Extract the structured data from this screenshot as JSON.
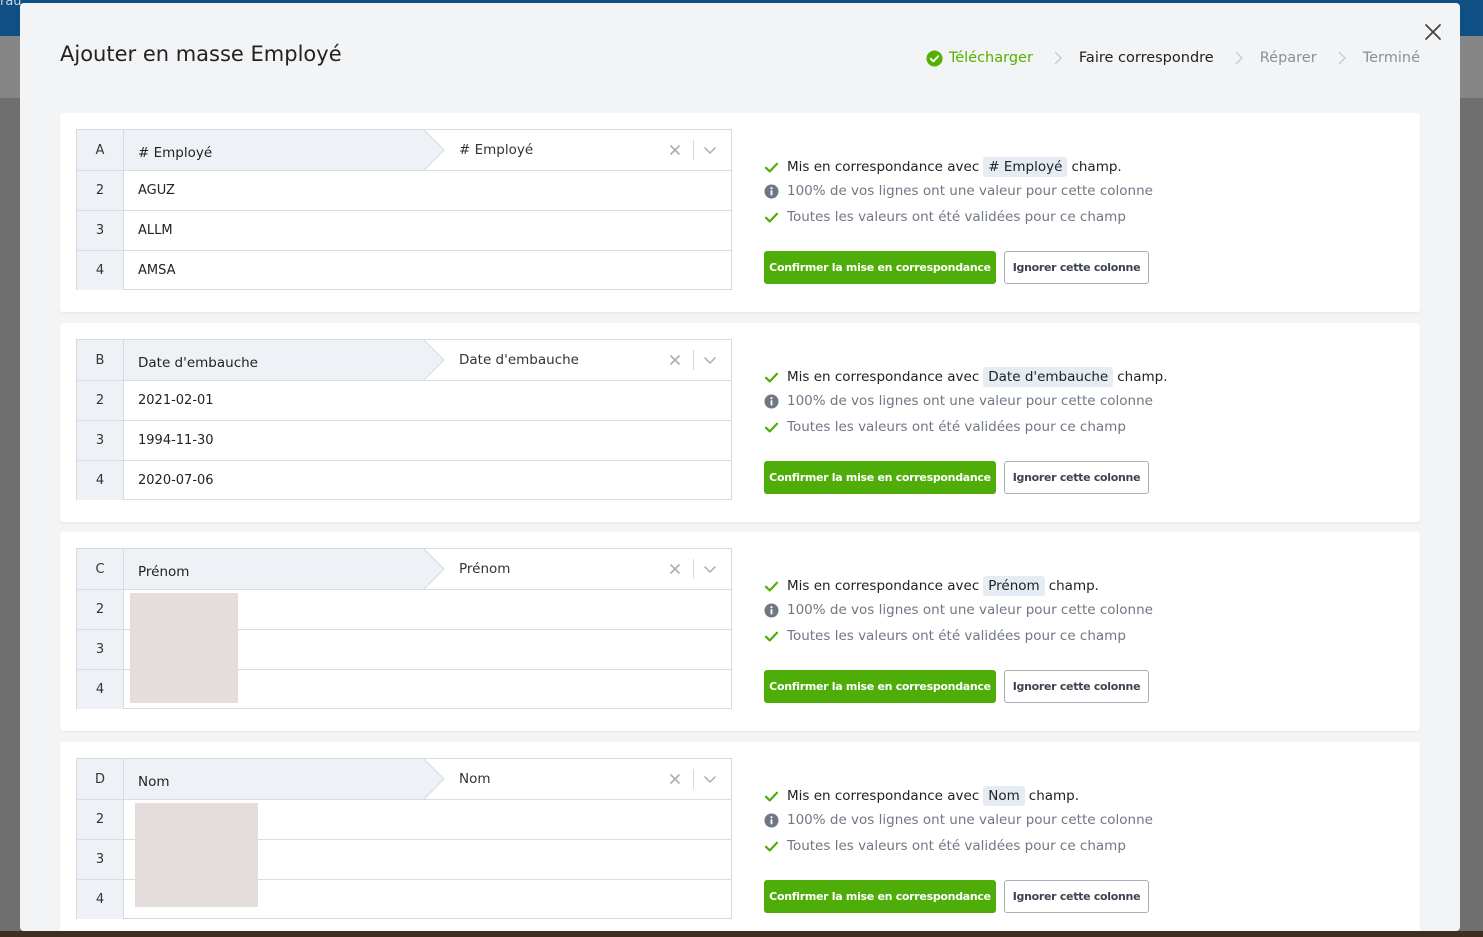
{
  "backdrop": {
    "corner_text": "rau"
  },
  "modal": {
    "title": "Ajouter en masse Employé",
    "close_icon": "close-icon",
    "steps": [
      {
        "label": "Télécharger",
        "state": "done"
      },
      {
        "label": "Faire correspondre",
        "state": "active"
      },
      {
        "label": "Réparer",
        "state": "todo"
      },
      {
        "label": "Terminé",
        "state": "todo"
      }
    ]
  },
  "columns": [
    {
      "letter": "A",
      "source_header": "# Employé",
      "mapped_field": "# Employé",
      "rows": [
        {
          "index": "2",
          "value": "AGUZ"
        },
        {
          "index": "3",
          "value": "ALLM"
        },
        {
          "index": "4",
          "value": "AMSA"
        }
      ],
      "matched_prefix": "Mis en correspondance avec",
      "matched_field": "# Employé",
      "matched_suffix": "champ.",
      "info_text": "100% de vos lignes ont une valeur pour cette colonne",
      "valid_text": "Toutes les valeurs ont été validées pour ce champ",
      "confirm_label": "Confirmer la mise en correspondance",
      "ignore_label": "Ignorer cette colonne"
    },
    {
      "letter": "B",
      "source_header": "Date d'embauche",
      "mapped_field": "Date d'embauche",
      "rows": [
        {
          "index": "2",
          "value": "2021-02-01"
        },
        {
          "index": "3",
          "value": "1994-11-30"
        },
        {
          "index": "4",
          "value": "2020-07-06"
        }
      ],
      "matched_prefix": "Mis en correspondance avec",
      "matched_field": "Date d'embauche",
      "matched_suffix": "champ.",
      "info_text": "100% de vos lignes ont une valeur pour cette colonne",
      "valid_text": "Toutes les valeurs ont été validées pour ce champ",
      "confirm_label": "Confirmer la mise en correspondance",
      "ignore_label": "Ignorer cette colonne"
    },
    {
      "letter": "C",
      "source_header": "Prénom",
      "mapped_field": "Prénom",
      "rows": [
        {
          "index": "2",
          "value": ""
        },
        {
          "index": "3",
          "value": ""
        },
        {
          "index": "4",
          "value": ""
        }
      ],
      "matched_prefix": "Mis en correspondance avec",
      "matched_field": "Prénom",
      "matched_suffix": "champ.",
      "info_text": "100% de vos lignes ont une valeur pour cette colonne",
      "valid_text": "Toutes les valeurs ont été validées pour ce champ",
      "confirm_label": "Confirmer la mise en correspondance",
      "ignore_label": "Ignorer cette colonne"
    },
    {
      "letter": "D",
      "source_header": "Nom",
      "mapped_field": "Nom",
      "rows": [
        {
          "index": "2",
          "value": ""
        },
        {
          "index": "3",
          "value": ""
        },
        {
          "index": "4",
          "value": ""
        }
      ],
      "matched_prefix": "Mis en correspondance avec",
      "matched_field": "Nom",
      "matched_suffix": "champ.",
      "info_text": "100% de vos lignes ont une valeur pour cette colonne",
      "valid_text": "Toutes les valeurs ont été validées pour ce champ",
      "confirm_label": "Confirmer la mise en correspondance",
      "ignore_label": "Ignorer cette colonne"
    }
  ],
  "colors": {
    "accent_green": "#4fad0a",
    "step_done": "#55b000",
    "step_todo": "#8a8f99",
    "header_bg": "#eef2f7"
  }
}
